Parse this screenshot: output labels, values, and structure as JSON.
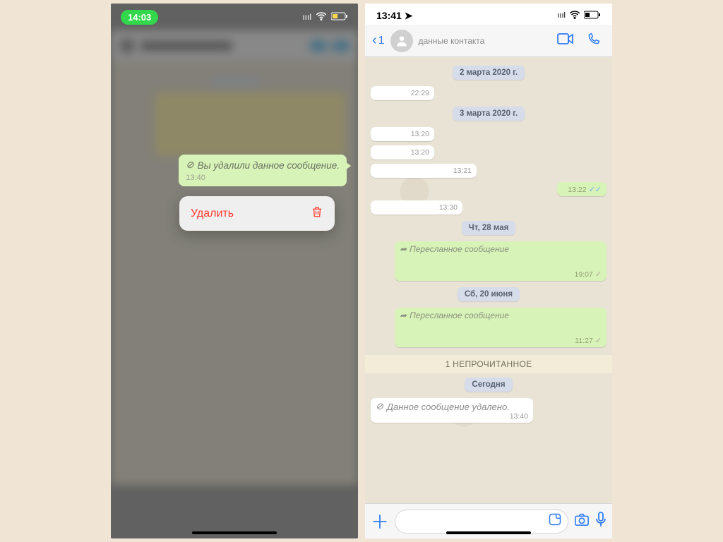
{
  "left": {
    "status_time": "14:03",
    "deleted_bubble": {
      "prefix_icon": "⊘",
      "text": "Вы удалили данное сообщение.",
      "time": "13:40"
    },
    "action": {
      "label": "Удалить",
      "icon": "trash-icon"
    }
  },
  "right": {
    "status_time": "13:41",
    "back_badge": "1",
    "contact_sub": "данные контакта",
    "dates": {
      "d1": "2 марта 2020 г.",
      "d2": "3 марта 2020 г.",
      "d3": "Чт, 28 мая",
      "d4": "Сб, 20 июня",
      "d5": "Сегодня"
    },
    "msgs": {
      "m1": {
        "time": "22:29"
      },
      "m2": {
        "time": "13:20"
      },
      "m3": {
        "time": "13:20"
      },
      "m4": {
        "time": "13:21"
      },
      "m5": {
        "time": "13:22"
      },
      "m6": {
        "time": "13:30"
      },
      "fwd_label": "Пересланное сообщение",
      "f1_time": "19:07",
      "f2_time": "11:27"
    },
    "unread": "1 НЕПРОЧИТАННОЕ",
    "deleted_in": {
      "text": "Данное сообщение удалено.",
      "time": "13:40"
    }
  }
}
